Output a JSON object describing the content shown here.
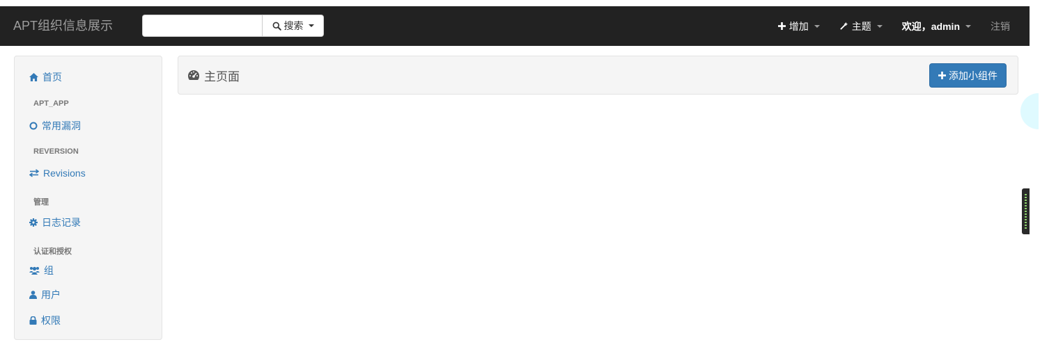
{
  "navbar": {
    "brand": "APT组织信息展示",
    "search": {
      "value": "",
      "placeholder": "",
      "button_label": "搜索"
    },
    "items": [
      {
        "label": "增加",
        "icon": "plus-icon"
      },
      {
        "label": "主题",
        "icon": "magic-wand-icon"
      },
      {
        "label": "欢迎，admin",
        "icon": ""
      },
      {
        "label": "注销",
        "icon": ""
      }
    ]
  },
  "sidebar": {
    "home": "首页",
    "sections": [
      {
        "header": "APT_APP",
        "items": [
          {
            "label": "常用漏洞",
            "icon": "circle-o-icon"
          }
        ]
      },
      {
        "header": "REVERSION",
        "items": [
          {
            "label": "Revisions",
            "icon": "exchange-icon"
          }
        ]
      },
      {
        "header": "管理",
        "items": [
          {
            "label": "日志记录",
            "icon": "gear-icon"
          }
        ]
      },
      {
        "header": "认证和授权",
        "items": [
          {
            "label": "组",
            "icon": "users-icon"
          },
          {
            "label": "用户",
            "icon": "user-icon"
          },
          {
            "label": "权限",
            "icon": "lock-icon"
          }
        ]
      }
    ]
  },
  "main": {
    "title": "主页面",
    "add_widget_label": "添加小组件"
  },
  "colors": {
    "navbar_bg": "#222222",
    "link": "#337ab7",
    "primary_button": "#337ab7",
    "panel_bg": "#f5f5f5"
  }
}
